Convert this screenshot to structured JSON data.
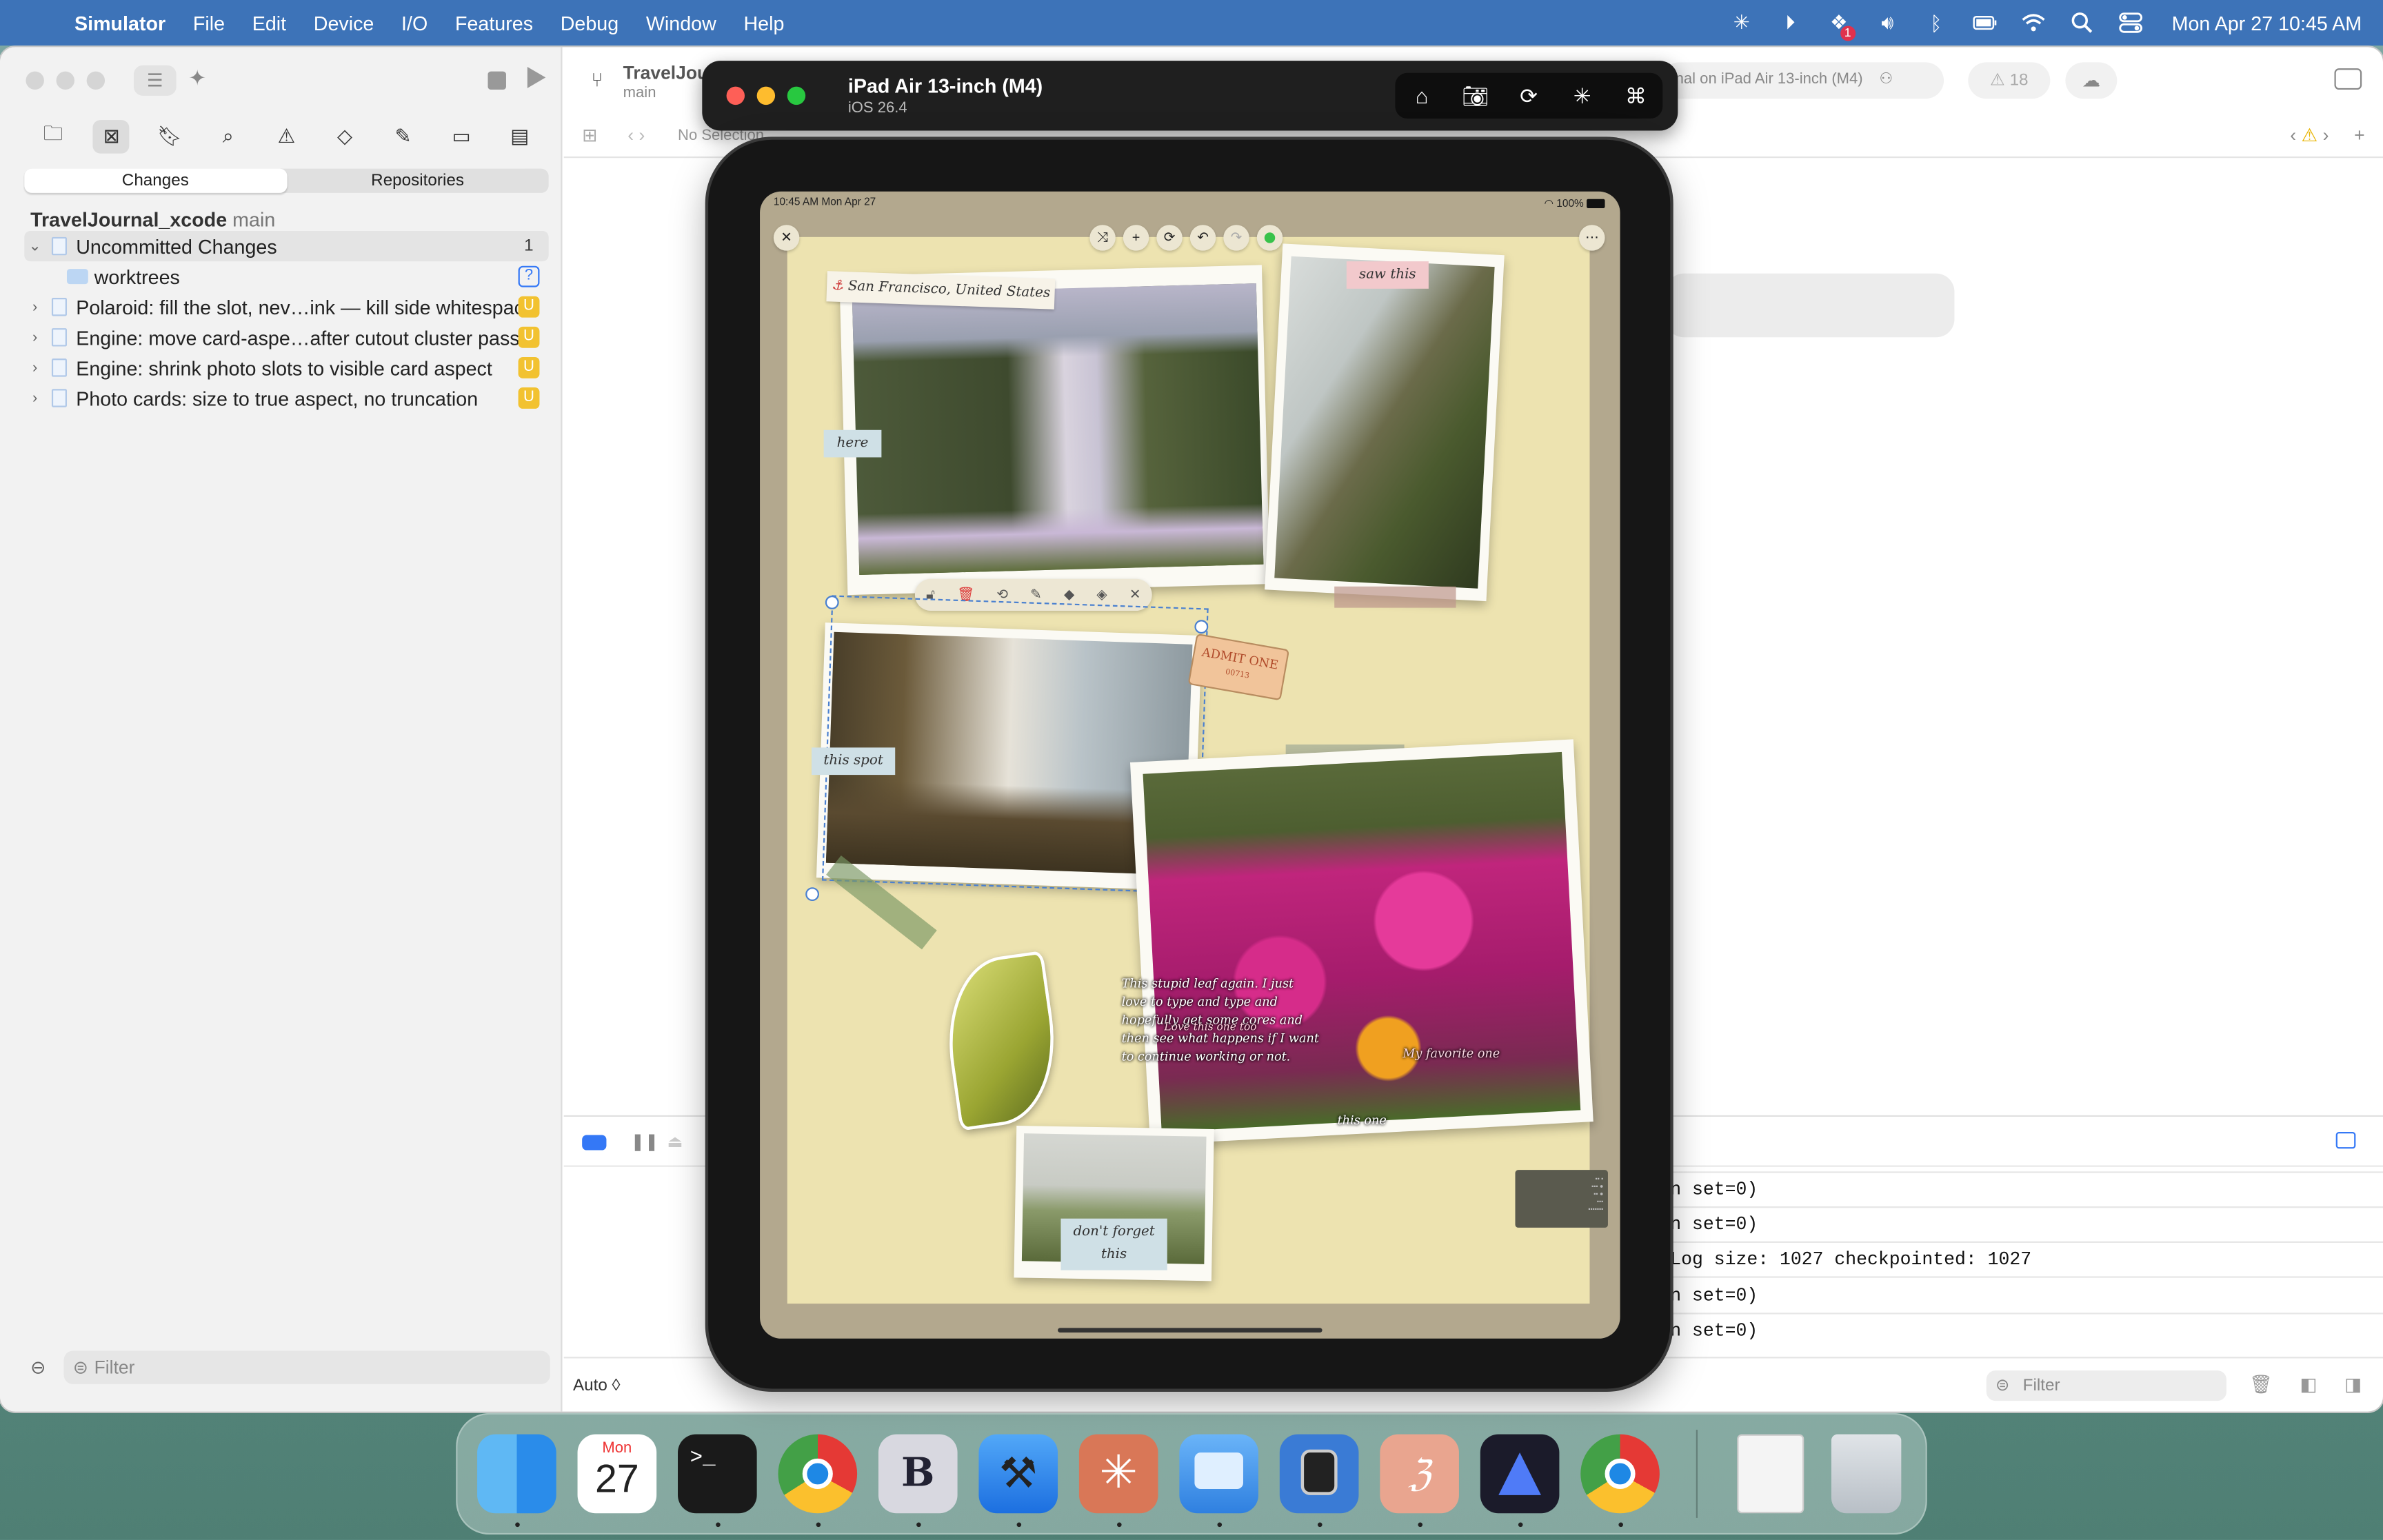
{
  "menubar": {
    "app_name": "Simulator",
    "items": [
      "File",
      "Edit",
      "Device",
      "I/O",
      "Features",
      "Debug",
      "Window",
      "Help"
    ],
    "clock": "Mon Apr 27  10:45 AM",
    "notification_badge": "1"
  },
  "navigator": {
    "tabs": {
      "changes": "Changes",
      "repositories": "Repositories"
    },
    "repo_name": "TravelJournal_xcode",
    "repo_branch": "main",
    "uncommitted_label": "Uncommitted Changes",
    "uncommitted_count": "1",
    "worktrees_label": "worktrees",
    "worktrees_badge": "?",
    "commits": [
      {
        "message": "Polaroid: fill the slot, nev…ink — kill side whitespace",
        "badge": "U"
      },
      {
        "message": "Engine: move card-aspe…after cutout cluster pass",
        "badge": "U"
      },
      {
        "message": "Engine: shrink photo slots to visible card aspect",
        "badge": "U"
      },
      {
        "message": "Photo cards: size to true aspect, no truncation",
        "badge": "U"
      }
    ],
    "filter_placeholder": "Filter"
  },
  "editor": {
    "project_title": "TravelJou",
    "project_branch": "main",
    "run_destination": "rnal on iPad Air 13-inch (M4)",
    "warning_count": "18",
    "jump_bar": "No Selection"
  },
  "console": {
    "lines": [
      "n set=0)",
      "n set=0)",
      "Log size: 1027 checkpointed: 1027",
      "n set=0)",
      "n set=0)"
    ],
    "auto_label": "Auto ◊",
    "filter_placeholder": "Filter"
  },
  "simulator": {
    "device_name": "iPad Air 13-inch (M4)",
    "os_version": "iOS 26.4",
    "status_time": "10:45 AM   Mon Apr 27",
    "battery": "100%",
    "journal": {
      "location_label": "San Francisco, United States",
      "stickers": {
        "here": "here",
        "saw_this": "saw this",
        "this_spot": "this spot",
        "admit_one": "ADMIT ONE",
        "ticket_no": "00713",
        "dont_forget": "don't forget this",
        "this_one": "this one",
        "my_favorite": "My favorite one"
      },
      "note_text": "This stupid leaf again. I just love to type and type and hopefully get some cores and then see what happens if I want to continue working or not.",
      "note_overlay": "Love this one too"
    }
  },
  "colors": {
    "menubar": "#3d73b8",
    "journal_page": "#ede3b0",
    "badge_yellow": "#f2c230",
    "accent_blue": "#3478f6"
  },
  "dock": {
    "calendar_month": "Mon",
    "calendar_day": "27",
    "terminal_glyph": ">_",
    "b_glyph": "B"
  }
}
